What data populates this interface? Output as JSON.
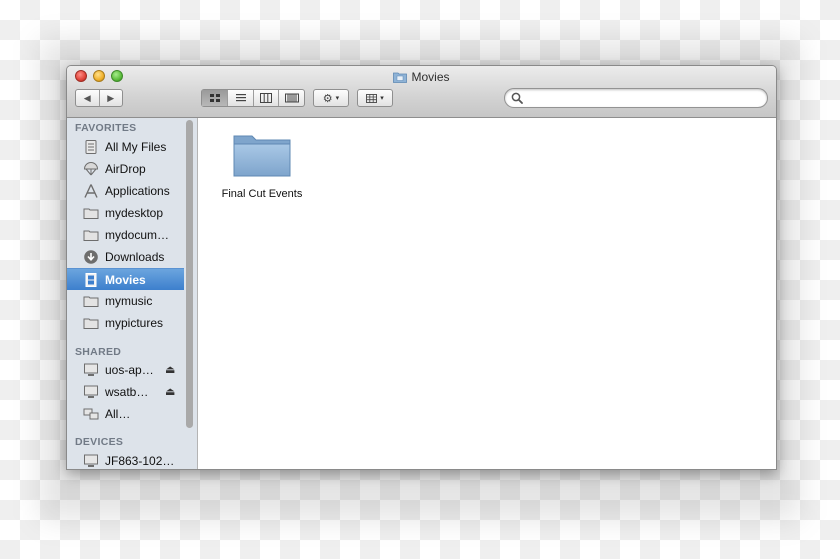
{
  "window": {
    "title": "Movies"
  },
  "toolbar": {
    "back_glyph": "◀",
    "forward_glyph": "▶",
    "views": [
      "icon-view",
      "list-view",
      "column-view",
      "coverflow-view"
    ],
    "active_view": "icon-view",
    "action_glyph": "⚙",
    "caret_glyph": "▾",
    "search_placeholder": ""
  },
  "sidebar": {
    "favorites_header": "FAVORITES",
    "favorites": [
      {
        "label": "All My Files",
        "icon": "all-files-icon"
      },
      {
        "label": "AirDrop",
        "icon": "airdrop-icon"
      },
      {
        "label": "Applications",
        "icon": "applications-icon"
      },
      {
        "label": "mydesktop",
        "icon": "folder-icon"
      },
      {
        "label": "mydocum…",
        "icon": "folder-icon"
      },
      {
        "label": "Downloads",
        "icon": "downloads-icon"
      },
      {
        "label": "Movies",
        "icon": "movies-icon",
        "selected": true
      },
      {
        "label": "mymusic",
        "icon": "folder-icon"
      },
      {
        "label": "mypictures",
        "icon": "folder-icon"
      }
    ],
    "shared_header": "SHARED",
    "shared": [
      {
        "label": "uos-ap…",
        "icon": "computer-icon",
        "eject": "⏏"
      },
      {
        "label": "wsatb…",
        "icon": "computer-icon",
        "eject": "⏏"
      },
      {
        "label": "All…",
        "icon": "network-icon"
      }
    ],
    "devices_header": "DEVICES",
    "devices": [
      {
        "label": "JF863-102…",
        "icon": "computer-icon"
      }
    ]
  },
  "content": {
    "items": [
      {
        "label": "Final Cut Events",
        "icon": "folder-icon"
      }
    ]
  },
  "colors": {
    "selection": "#3d7fcd",
    "sidebar_bg": "#dde3ea",
    "folder": "#8fb3d6"
  }
}
